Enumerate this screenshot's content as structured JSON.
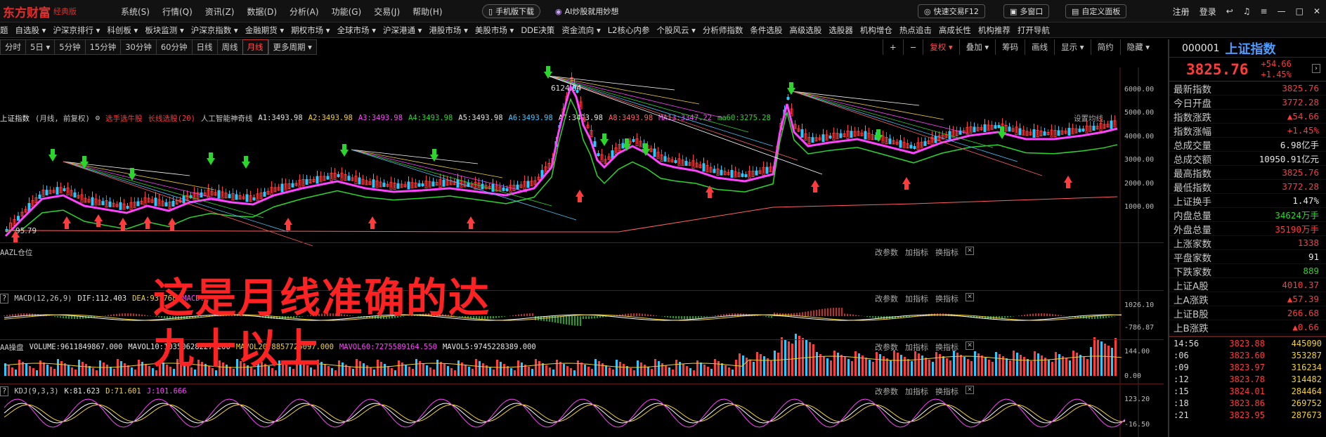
{
  "app": {
    "brand": "东方财富",
    "edition": "经典版"
  },
  "top_menu": [
    "系统(S)",
    "行情(Q)",
    "资讯(Z)",
    "数据(D)",
    "分析(A)",
    "功能(G)",
    "交易(J)",
    "帮助(H)"
  ],
  "pills": {
    "mobile": "手机版下载",
    "ai": "AI炒股就用妙想",
    "quick_trade": "快速交易F12",
    "multi_window": "多窗口",
    "custom_panel": "自定义面板"
  },
  "account": {
    "register": "注册",
    "login": "登录"
  },
  "nav": [
    "题",
    "自选股 ▾",
    "沪深京排行 ▾",
    "科创板 ▾",
    "板块监测 ▾",
    "沪深京指数 ▾",
    "金融期货 ▾",
    "期权市场 ▾",
    "全球市场 ▾",
    "沪深港通 ▾",
    "港股市场 ▾",
    "美股市场 ▾",
    "DDE决策",
    "资金流向 ▾",
    "L2核心内参",
    "个股风云 ▾",
    "分析师指数",
    "条件选股",
    "高级选股",
    "选股器",
    "机构增仓",
    "热点追击",
    "高成长性",
    "机构推荐",
    "打开导航"
  ],
  "periods": [
    "分时",
    "5日 ▾",
    "5分钟",
    "15分钟",
    "30分钟",
    "60分钟",
    "日线",
    "周线",
    "月线",
    "更多周期 ▾"
  ],
  "active_period": "月线",
  "chart_tools": [
    "复权 ▾",
    "叠加 ▾",
    "筹码",
    "画线",
    "显示 ▾",
    "简约",
    "隐藏 ▾"
  ],
  "main_header": {
    "name": "上证指数",
    "mode": "(月线, 前复权)",
    "buy": "选手选牛股",
    "sell": "长线选股(20)",
    "ai": "人工智能神奇线",
    "ma": [
      {
        "t": "A1:3493.98",
        "c": "#e6e6e6"
      },
      {
        "t": "A2:3493.98",
        "c": "#f2d232"
      },
      {
        "t": "A3:3493.98",
        "c": "#ff44ff"
      },
      {
        "t": "A4:3493.98",
        "c": "#2bd62b"
      },
      {
        "t": "A5:3493.98",
        "c": "#e6e6e6"
      },
      {
        "t": "A6:3493.98",
        "c": "#44c8ff"
      },
      {
        "t": "A7:3493.98",
        "c": "#e6e6e6"
      },
      {
        "t": "A8:3493.98",
        "c": "#ff6060"
      },
      {
        "t": "MA13:3347.22",
        "c": "#ff44ff"
      },
      {
        "t": "ma60:3275.28",
        "c": "#2bd62b"
      }
    ],
    "settings": "设置均线"
  },
  "price_axis": [
    "6000.00",
    "5000.00",
    "4000.00",
    "3000.00",
    "2000.00",
    "1000.00"
  ],
  "annotations": {
    "high": "6124.04",
    "low": "95.79"
  },
  "aazl": "AAZL仓位",
  "sub_controls": [
    "改参数",
    "加指标",
    "换指标"
  ],
  "macd": {
    "label": "MACD(12,26,9)",
    "dif": "DIF:112.403",
    "dea": "DEA:93.768",
    "macd": "MACD:",
    "axis_top": "1026.10",
    "axis_bot": "-786.87"
  },
  "vol": {
    "label": "AA操盘",
    "volume": "VOLUME:9611849867.000",
    "mavol10": "MAVOL10:10350628227.200",
    "mavol20": "MAVOL20:8857725097.000",
    "mavol60": "MAVOL60:7275589164.550",
    "mavol5": "MAVOL5:9745228389.000",
    "axis_top": "144.00",
    "axis_bot": "0.00"
  },
  "kdj": {
    "label": "KDJ(9,3,3)",
    "k": "K:81.623",
    "d": "D:71.601",
    "j": "J:101.666",
    "axis_top": "123.20",
    "axis_bot": "-16.50"
  },
  "overlay_text": [
    "这是月线准确的达",
    "九十以上"
  ],
  "side": {
    "code": "000001",
    "name": "上证指数",
    "price": "3825.76",
    "change": "+54.66",
    "pct": "+1.45%",
    "rows": [
      {
        "k": "最新指数",
        "v": "3825.76",
        "c": "red"
      },
      {
        "k": "今日开盘",
        "v": "3772.28",
        "c": "red"
      },
      {
        "k": "指数涨跌",
        "v": "▲54.66",
        "c": "red"
      },
      {
        "k": "指数涨幅",
        "v": "+1.45%",
        "c": "red"
      },
      {
        "k": "总成交量",
        "v": "6.98亿手",
        "c": "white"
      },
      {
        "k": "总成交额",
        "v": "10950.91亿元",
        "c": "white"
      },
      {
        "k": "最高指数",
        "v": "3825.76",
        "c": "red"
      },
      {
        "k": "最低指数",
        "v": "3772.28",
        "c": "red"
      },
      {
        "k": "上证换手",
        "v": "1.47%",
        "c": "white"
      },
      {
        "k": "内盘总量",
        "v": "34624万手",
        "c": "green"
      },
      {
        "k": "外盘总量",
        "v": "35190万手",
        "c": "red"
      },
      {
        "k": "上涨家数",
        "v": "1338",
        "c": "red"
      },
      {
        "k": "平盘家数",
        "v": "91",
        "c": "white"
      },
      {
        "k": "下跌家数",
        "v": "889",
        "c": "green"
      },
      {
        "k": "上证A股",
        "v": "4010.37",
        "c": "red"
      },
      {
        "k": "上A涨跌",
        "v": "▲57.39",
        "c": "red"
      },
      {
        "k": "上证B股",
        "v": "266.68",
        "c": "red"
      },
      {
        "k": "上B涨跌",
        "v": "▲0.66",
        "c": "red"
      }
    ],
    "ticks": [
      {
        "t": "14:56",
        "p": "3823.88",
        "v": "445090"
      },
      {
        "t": ":06",
        "p": "3823.60",
        "v": "353287"
      },
      {
        "t": ":09",
        "p": "3823.97",
        "v": "316234"
      },
      {
        "t": ":12",
        "p": "3823.78",
        "v": "314482"
      },
      {
        "t": ":15",
        "p": "3824.01",
        "v": "284464"
      },
      {
        "t": ":18",
        "p": "3823.86",
        "v": "269752"
      },
      {
        "t": ":21",
        "p": "3823.95",
        "v": "287673"
      }
    ]
  }
}
